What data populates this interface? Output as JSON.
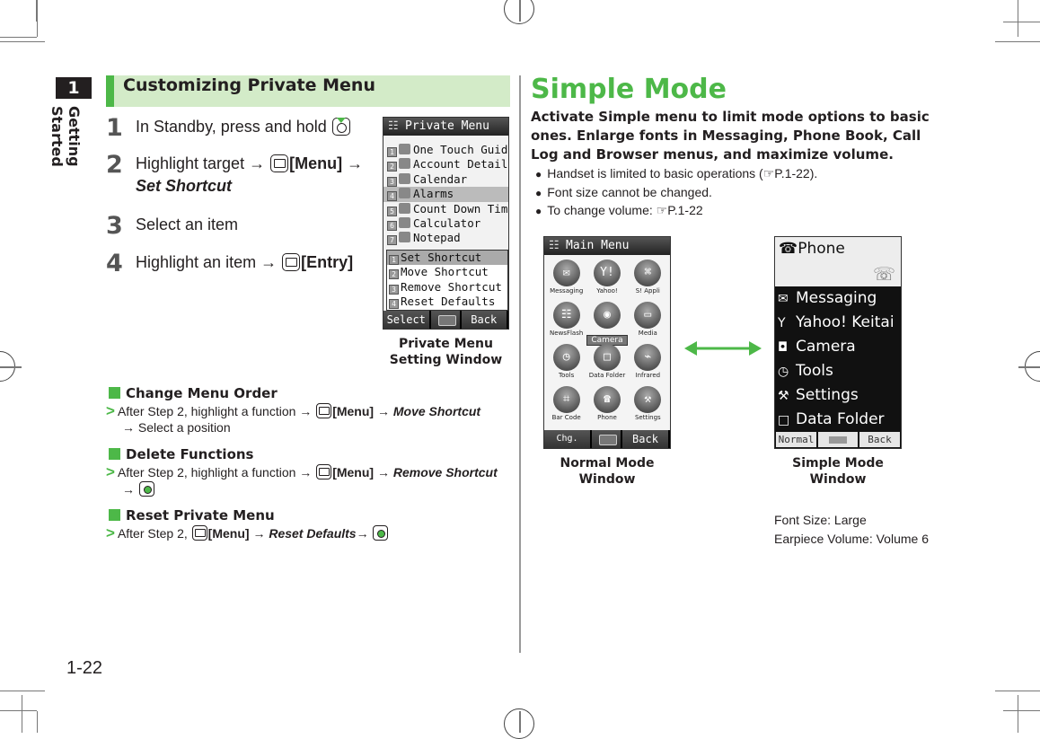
{
  "chapter": {
    "number": "1",
    "title": "Getting Started"
  },
  "page_number": "1-22",
  "left": {
    "section_title": "Customizing Private Menu",
    "steps": [
      {
        "num": "1",
        "text": "In Standby, press and hold",
        "key": "camera-key"
      },
      {
        "num": "2",
        "pre": "Highlight target →",
        "key_label": "[Menu]",
        "post": "→",
        "line2": "Set Shortcut"
      },
      {
        "num": "3",
        "text": "Select an item"
      },
      {
        "num": "4",
        "pre": "Highlight an item →",
        "key_label": "[Entry]"
      }
    ],
    "private_menu_screen": {
      "title": "Private Menu",
      "items": [
        {
          "n": "1",
          "label": "One Touch Guide"
        },
        {
          "n": "2",
          "label": "Account Details"
        },
        {
          "n": "3",
          "label": "Calendar"
        },
        {
          "n": "4",
          "label": "Alarms",
          "highlighted": true
        },
        {
          "n": "5",
          "label": "Count Down Timer"
        },
        {
          "n": "6",
          "label": "Calculator"
        },
        {
          "n": "7",
          "label": "Notepad"
        }
      ],
      "submenu": [
        {
          "n": "1",
          "label": "Set Shortcut",
          "highlighted": true
        },
        {
          "n": "2",
          "label": "Move Shortcut"
        },
        {
          "n": "3",
          "label": "Remove Shortcut"
        },
        {
          "n": "4",
          "label": "Reset Defaults"
        }
      ],
      "softkeys": {
        "left": "Select",
        "right": "Back"
      },
      "caption": "Private Menu Setting Window"
    },
    "subsections": [
      {
        "title": "Change Menu Order",
        "line1_pre": "After Step 2, highlight a function →",
        "key_label": "[Menu]",
        "line1_post": "→",
        "action": "Move Shortcut",
        "line2": "→ Select a position"
      },
      {
        "title": "Delete Functions",
        "line1_pre": "After Step 2, highlight a function →",
        "key_label": "[Menu]",
        "line1_post": "→",
        "action": "Remove Shortcut",
        "line2": "→"
      },
      {
        "title": "Reset Private Menu",
        "line1_pre": "After Step 2,",
        "key_label": "[Menu]",
        "line1_post": "→",
        "action": "Reset Defaults",
        "line1_end": "→"
      }
    ]
  },
  "right": {
    "title": "Simple Mode",
    "lead": "Activate Simple menu to limit mode options to basic ones. Enlarge fonts in Messaging, Phone Book, Call Log and Browser menus, and maximize volume.",
    "bullets": [
      {
        "text": "Handset is limited to basic operations (",
        "ref": "P.1-22",
        "end": ")."
      },
      {
        "text": "Font size cannot be changed."
      },
      {
        "text": "To change volume: ",
        "ref": "P.1-22"
      }
    ],
    "normal_mode_screen": {
      "title": "Main Menu",
      "icons": [
        {
          "label": "Messaging",
          "glyph": "✉"
        },
        {
          "label": "Yahoo!",
          "glyph": "Y!"
        },
        {
          "label": "S! Appli",
          "glyph": "⌘"
        },
        {
          "label": "NewsFlash",
          "glyph": "☷"
        },
        {
          "label": "Camera",
          "glyph": "◉",
          "selected": true
        },
        {
          "label": "Media",
          "glyph": "▭"
        },
        {
          "label": "Tools",
          "glyph": "◷"
        },
        {
          "label": "Data Folder",
          "glyph": "□"
        },
        {
          "label": "Infrared",
          "glyph": "⌁"
        },
        {
          "label": "Bar Code",
          "glyph": "⌗"
        },
        {
          "label": "Phone",
          "glyph": "☎"
        },
        {
          "label": "Settings",
          "glyph": "⚒"
        }
      ],
      "softkeys": {
        "left": "Chg. Menu",
        "right": "Back"
      },
      "caption": "Normal Mode Window"
    },
    "simple_mode_screen": {
      "header": "Phone",
      "items": [
        {
          "label": "Messaging",
          "glyph": "✉"
        },
        {
          "label": "Yahoo! Keitai",
          "glyph": "Y"
        },
        {
          "label": "Camera",
          "glyph": "◘"
        },
        {
          "label": "Tools",
          "glyph": "◷"
        },
        {
          "label": "Settings",
          "glyph": "⚒"
        },
        {
          "label": "Data Folder",
          "glyph": "□"
        }
      ],
      "softkeys": {
        "left": "Normal",
        "right": "Back"
      },
      "caption": "Simple Mode Window"
    },
    "notes": [
      "Font Size: Large",
      "Earpiece Volume: Volume 6"
    ]
  },
  "colors": {
    "accent": "#4db848",
    "section_bg": "#d3ebc8",
    "text": "#231f20"
  }
}
